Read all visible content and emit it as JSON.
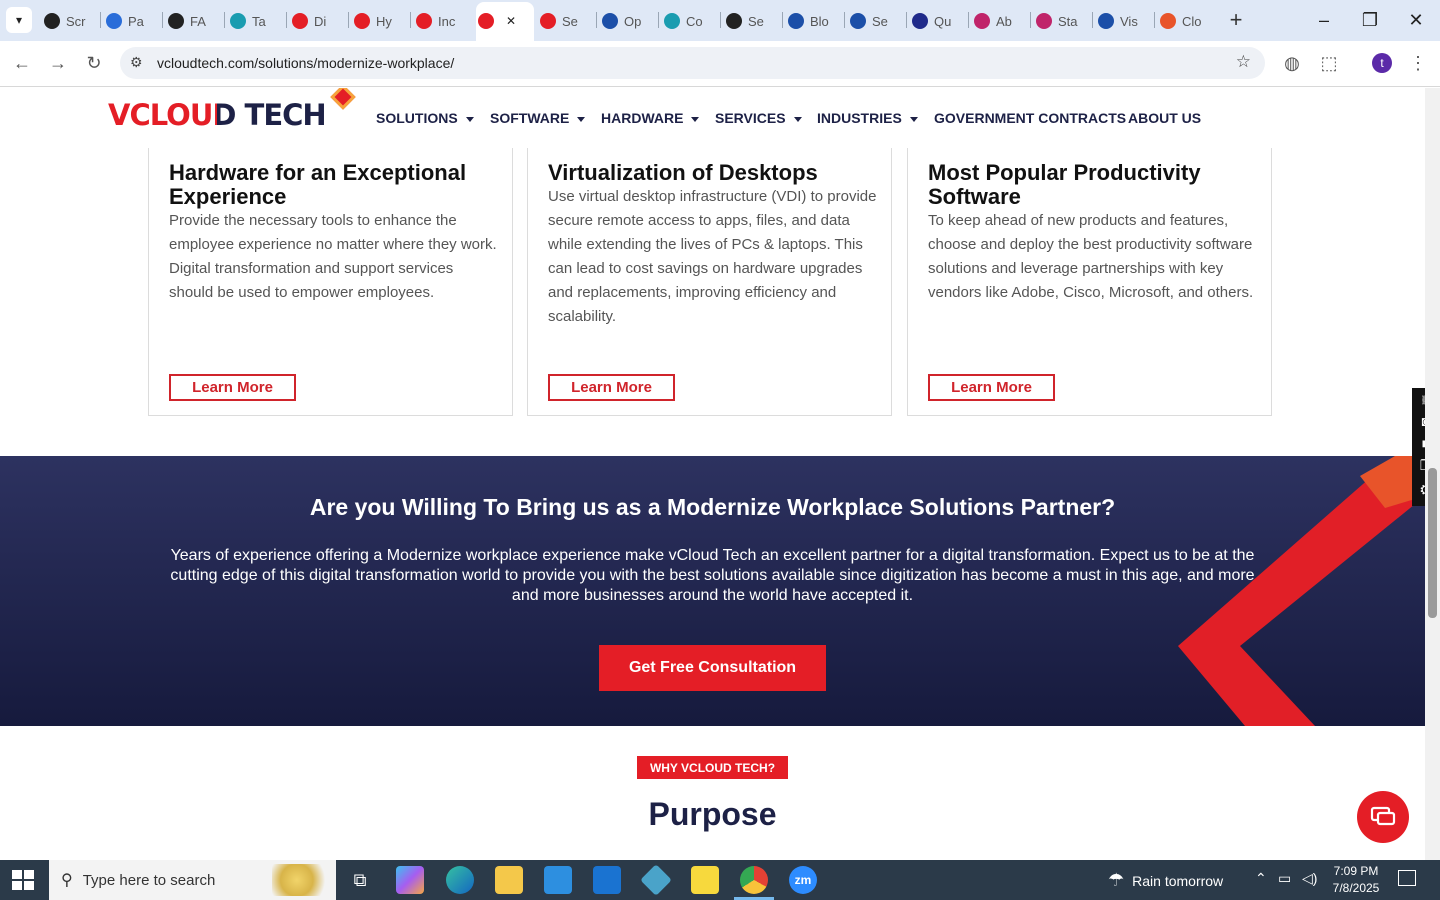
{
  "browser": {
    "tabs": [
      "Scr",
      "Pa",
      "FA",
      "Ta",
      "Di",
      "Hy",
      "Inc",
      "",
      "Se",
      "Op",
      "Co",
      "Se",
      "Blo",
      "Se",
      "Qu",
      "Ab",
      "Sta",
      "Vis",
      "Clo"
    ],
    "url": "vcloudtech.com/solutions/modernize-workplace/"
  },
  "site": {
    "logo": "VCLOUD TECH",
    "nav": [
      "SOLUTIONS",
      "SOFTWARE",
      "HARDWARE",
      "SERVICES",
      "INDUSTRIES",
      "GOVERNMENT CONTRACTS",
      "ABOUT US"
    ]
  },
  "cards": [
    {
      "title": "Hardware for an Exceptional Experience",
      "body": "Provide the necessary tools to enhance the employee experience no matter where they work. Digital transformation and support services should be used to empower employees.",
      "button": "Learn More"
    },
    {
      "title": "Virtualization of Desktops",
      "body": "Use virtual desktop infrastructure (VDI) to provide secure remote access to apps, files, and data while extending the lives of PCs & laptops. This can lead to cost savings on hardware upgrades and replacements, improving efficiency and scalability.",
      "button": "Learn More"
    },
    {
      "title": "Most Popular Productivity Software",
      "body": "To keep ahead of new products and features, choose and deploy the best productivity software solutions and leverage partnerships with key vendors like Adobe, Cisco, Microsoft, and others.",
      "button": "Learn More"
    }
  ],
  "banner": {
    "heading": "Are you Willing To Bring us as a Modernize Workplace Solutions Partner?",
    "text": "Years of experience offering a Modernize workplace experience make vCloud Tech an excellent partner for a digital transformation. Expect us to be at the cutting edge of this digital transformation world to provide you with the best solutions available since digitization has become a must in this age, and more and more businesses around the world have accepted it.",
    "cta": "Get Free Consultation"
  },
  "why": {
    "badge": "WHY VCLOUD TECH?",
    "heading": "Purpose"
  },
  "taskbar": {
    "search_placeholder": "Type here to search",
    "weather": "Rain tomorrow",
    "time": "7:09 PM",
    "date": "7/8/2025"
  },
  "colors": {
    "accent": "#e41e26",
    "navy": "#1d2146"
  }
}
